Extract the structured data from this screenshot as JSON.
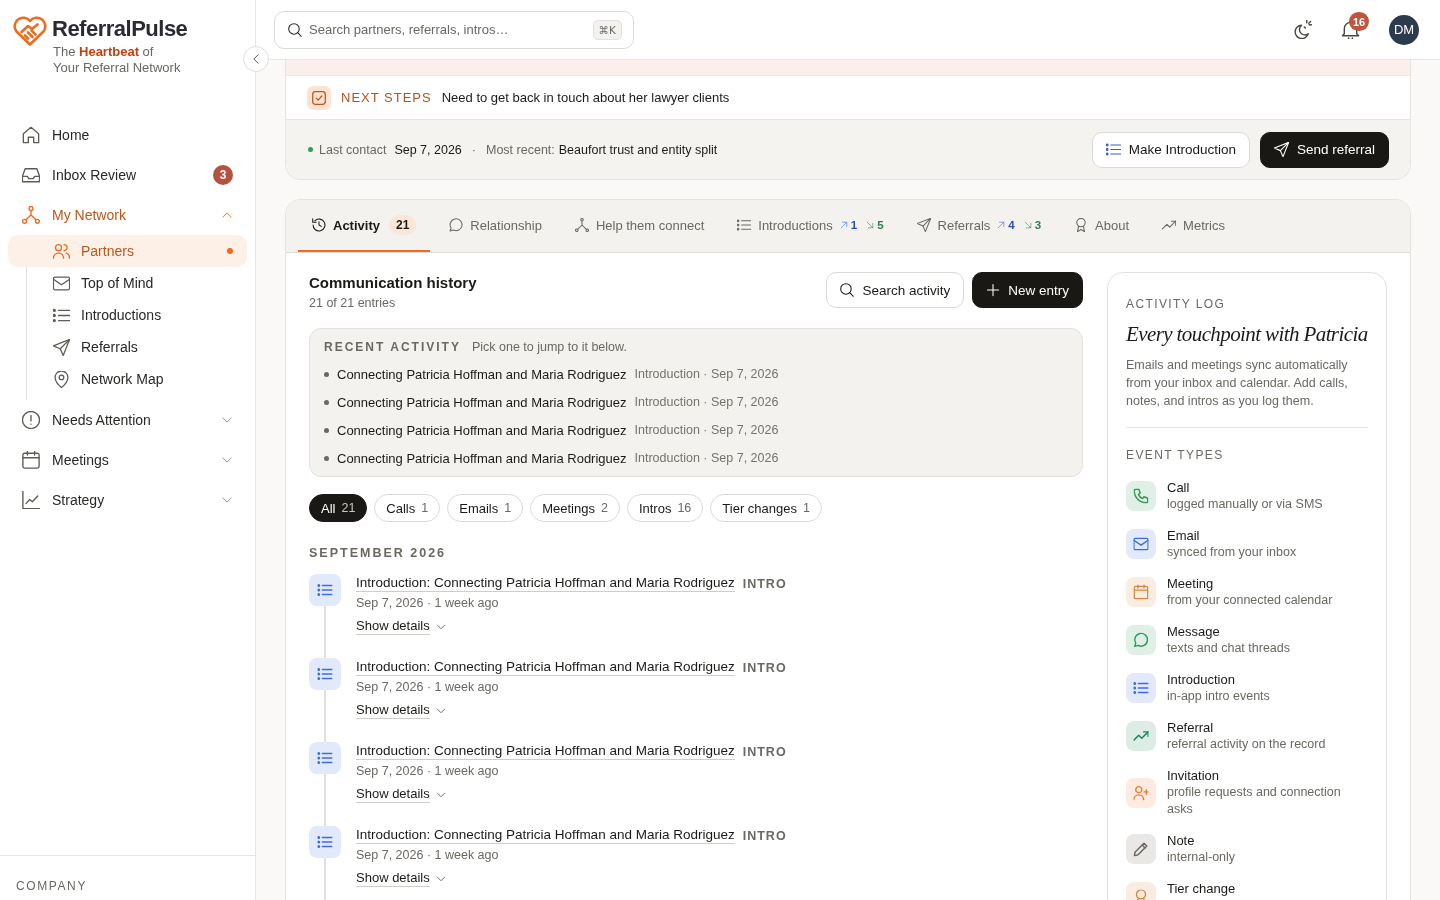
{
  "brand": {
    "name": "ReferralPulse",
    "tagline": [
      "The **Heartbeat** of",
      "Your Referral Network"
    ]
  },
  "sidebar": {
    "items": [
      {
        "kind": "link",
        "label": "Home",
        "selected": false
      },
      {
        "kind": "link",
        "label": "Inbox Review",
        "selected": false,
        "badge": "3"
      },
      {
        "kind": "group",
        "label": "My Network",
        "selected": true,
        "expanded": true,
        "children": [
          {
            "label": "Partners",
            "selected": true,
            "marked": true
          },
          {
            "label": "Top of Mind",
            "selected": false,
            "marked": false
          },
          {
            "label": "Introductions",
            "selected": false,
            "marked": false
          },
          {
            "label": "Referrals",
            "selected": false,
            "marked": false
          },
          {
            "label": "Network Map",
            "selected": false,
            "marked": false
          }
        ]
      },
      {
        "kind": "group",
        "label": "Needs Attention",
        "selected": false,
        "expanded": false
      },
      {
        "kind": "group",
        "label": "Meetings",
        "selected": false,
        "expanded": false
      },
      {
        "kind": "group",
        "label": "Strategy",
        "selected": false,
        "expanded": false
      }
    ],
    "footer_section": "COMPANY"
  },
  "topbar": {
    "search": {
      "placeholder": "Search partners, referrals, intros…",
      "shortcut": "⌘K"
    },
    "notifications": "16",
    "avatar": "DM"
  },
  "partner_header": {
    "next_steps": {
      "label": "NEXT STEPS",
      "text": "Need to get back in touch about her lawyer clients"
    },
    "last_contact": {
      "label": "Last contact",
      "date": "Sep 7, 2026",
      "separator": "·",
      "recent_label": "Most recent:",
      "recent": "Beaufort trust and entity split"
    },
    "buttons": [
      {
        "label": "Make Introduction",
        "kind": "secondary"
      },
      {
        "label": "Send referral",
        "kind": "primary"
      }
    ]
  },
  "tabs": [
    {
      "label": "Activity",
      "selected": true,
      "count": "21"
    },
    {
      "label": "Relationship",
      "selected": false
    },
    {
      "label": "Help them connect",
      "selected": false
    },
    {
      "label": "Introductions",
      "selected": false,
      "up_count": "1",
      "down_count": "5"
    },
    {
      "label": "Referrals",
      "selected": false,
      "up_count": "4",
      "down_count": "3"
    },
    {
      "label": "About",
      "selected": false
    },
    {
      "label": "Metrics",
      "selected": false
    }
  ],
  "history": {
    "title": "Communication history",
    "subtitle": "21 of 21 entries",
    "buttons": [
      {
        "label": "Search activity",
        "kind": "secondary"
      },
      {
        "label": "New entry",
        "kind": "primary"
      }
    ],
    "recent": {
      "label": "RECENT ACTIVITY",
      "hint": "Pick one to jump to it below.",
      "items": [
        {
          "title": "Connecting Patricia Hoffman and Maria Rodriguez",
          "meta": "Introduction · Sep 7, 2026"
        },
        {
          "title": "Connecting Patricia Hoffman and Maria Rodriguez",
          "meta": "Introduction · Sep 7, 2026"
        },
        {
          "title": "Connecting Patricia Hoffman and Maria Rodriguez",
          "meta": "Introduction · Sep 7, 2026"
        },
        {
          "title": "Connecting Patricia Hoffman and Maria Rodriguez",
          "meta": "Introduction · Sep 7, 2026"
        }
      ]
    },
    "filters": [
      {
        "label": "All",
        "count": "21",
        "selected": true
      },
      {
        "label": "Calls",
        "count": "1",
        "selected": false
      },
      {
        "label": "Emails",
        "count": "1",
        "selected": false
      },
      {
        "label": "Meetings",
        "count": "2",
        "selected": false
      },
      {
        "label": "Intros",
        "count": "16",
        "selected": false
      },
      {
        "label": "Tier changes",
        "count": "1",
        "selected": false
      }
    ],
    "month": "SEPTEMBER 2026",
    "entries": [
      {
        "kind": "introduction",
        "title": "Introduction: Connecting Patricia Hoffman and Maria Rodriguez",
        "tag": "INTRO",
        "meta": "Sep 7, 2026 · 1 week ago",
        "toggle": "Show details"
      },
      {
        "kind": "introduction",
        "title": "Introduction: Connecting Patricia Hoffman and Maria Rodriguez",
        "tag": "INTRO",
        "meta": "Sep 7, 2026 · 1 week ago",
        "toggle": "Show details"
      },
      {
        "kind": "introduction",
        "title": "Introduction: Connecting Patricia Hoffman and Maria Rodriguez",
        "tag": "INTRO",
        "meta": "Sep 7, 2026 · 1 week ago",
        "toggle": "Show details"
      },
      {
        "kind": "introduction",
        "title": "Introduction: Connecting Patricia Hoffman and Maria Rodriguez",
        "tag": "INTRO",
        "meta": "Sep 7, 2026 · 1 week ago",
        "toggle": "Show details"
      }
    ]
  },
  "activity_log": {
    "eyebrow": "ACTIVITY LOG",
    "heading": "Every touchpoint with Patricia",
    "description": "Emails and meetings sync automatically from your inbox and calendar. Add calls, notes, and intros as you log them.",
    "section": "EVENT TYPES",
    "event_types": [
      {
        "kind": "call",
        "label": "Call",
        "description": "logged manually or via SMS",
        "color": "#e0f0e6"
      },
      {
        "kind": "email",
        "label": "Email",
        "description": "synced from your inbox",
        "color": "#e2e9fa"
      },
      {
        "kind": "meeting",
        "label": "Meeting",
        "description": "from your connected calendar",
        "color": "#f9ede2"
      },
      {
        "kind": "message",
        "label": "Message",
        "description": "texts and chat threads",
        "color": "#e0f0e6"
      },
      {
        "kind": "introduction",
        "label": "Introduction",
        "description": "in-app intro events",
        "color": "#e2e9fa"
      },
      {
        "kind": "referral",
        "label": "Referral",
        "description": "referral activity on the record",
        "color": "#ddede6"
      },
      {
        "kind": "invitation",
        "label": "Invitation",
        "description": "profile requests and connection asks",
        "color": "#fdebe1"
      },
      {
        "kind": "note",
        "label": "Note",
        "description": "internal-only",
        "color": "#e9e8e7"
      },
      {
        "kind": "tier",
        "label": "Tier change",
        "color": "#f9ede2"
      }
    ]
  }
}
